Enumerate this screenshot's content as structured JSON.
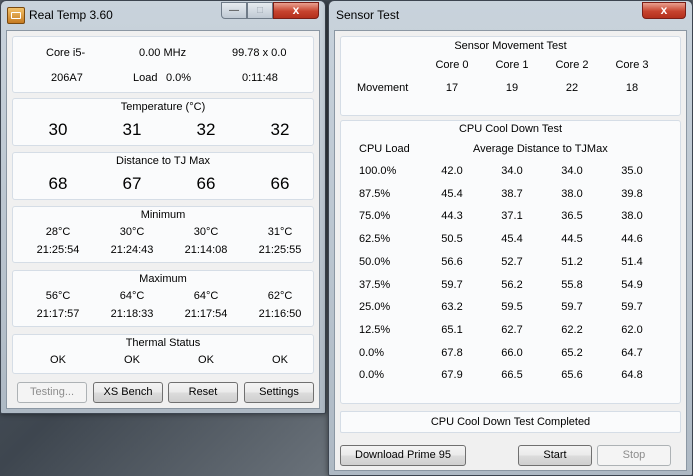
{
  "realtemp": {
    "title": "Real Temp 3.60",
    "window_buttons": {
      "minimize": "—",
      "maximize": "□",
      "close": "x"
    },
    "cpu": {
      "name": "Core i5-",
      "code": "206A7",
      "mhz": "0.00 MHz",
      "load_label": "Load",
      "load": "0.0%",
      "multiplier": "99.78 x 0.0",
      "time": "0:11:48"
    },
    "temperature": {
      "heading": "Temperature (°C)",
      "values": [
        "30",
        "31",
        "32",
        "32"
      ]
    },
    "distance": {
      "heading": "Distance to TJ Max",
      "values": [
        "68",
        "67",
        "66",
        "66"
      ]
    },
    "minimum": {
      "heading": "Minimum",
      "temps": [
        "28°C",
        "30°C",
        "30°C",
        "31°C"
      ],
      "times": [
        "21:25:54",
        "21:24:43",
        "21:14:08",
        "21:25:55"
      ]
    },
    "maximum": {
      "heading": "Maximum",
      "temps": [
        "56°C",
        "64°C",
        "64°C",
        "62°C"
      ],
      "times": [
        "21:17:57",
        "21:18:33",
        "21:17:54",
        "21:16:50"
      ]
    },
    "thermal": {
      "heading": "Thermal Status",
      "values": [
        "OK",
        "OK",
        "OK",
        "OK"
      ]
    },
    "buttons": {
      "testing": "Testing...",
      "xs_bench": "XS Bench",
      "reset": "Reset",
      "settings": "Settings"
    }
  },
  "sensor": {
    "title": "Sensor Test",
    "window_buttons": {
      "close": "x"
    },
    "movement": {
      "heading": "Sensor Movement Test",
      "cores": [
        "Core 0",
        "Core 1",
        "Core 2",
        "Core 3"
      ],
      "row_label": "Movement",
      "values": [
        "17",
        "19",
        "22",
        "18"
      ]
    },
    "cooldown": {
      "heading": "CPU Cool Down Test",
      "col_load": "CPU Load",
      "col_avg": "Average Distance to TJMax",
      "rows": [
        {
          "load": "100.0%",
          "values": [
            "42.0",
            "34.0",
            "34.0",
            "35.0"
          ]
        },
        {
          "load": "87.5%",
          "values": [
            "45.4",
            "38.7",
            "38.0",
            "39.8"
          ]
        },
        {
          "load": "75.0%",
          "values": [
            "44.3",
            "37.1",
            "36.5",
            "38.0"
          ]
        },
        {
          "load": "62.5%",
          "values": [
            "50.5",
            "45.4",
            "44.5",
            "44.6"
          ]
        },
        {
          "load": "50.0%",
          "values": [
            "56.6",
            "52.7",
            "51.2",
            "51.4"
          ]
        },
        {
          "load": "37.5%",
          "values": [
            "59.7",
            "56.2",
            "55.8",
            "54.9"
          ]
        },
        {
          "load": "25.0%",
          "values": [
            "63.2",
            "59.5",
            "59.7",
            "59.7"
          ]
        },
        {
          "load": "12.5%",
          "values": [
            "65.1",
            "62.7",
            "62.2",
            "62.0"
          ]
        },
        {
          "load": "0.0%",
          "values": [
            "67.8",
            "66.0",
            "65.2",
            "64.7"
          ]
        },
        {
          "load": "0.0%",
          "values": [
            "67.9",
            "66.5",
            "65.6",
            "64.8"
          ]
        }
      ]
    },
    "status": "CPU Cool Down Test Completed",
    "buttons": {
      "download": "Download Prime 95",
      "start": "Start",
      "stop": "Stop"
    }
  }
}
